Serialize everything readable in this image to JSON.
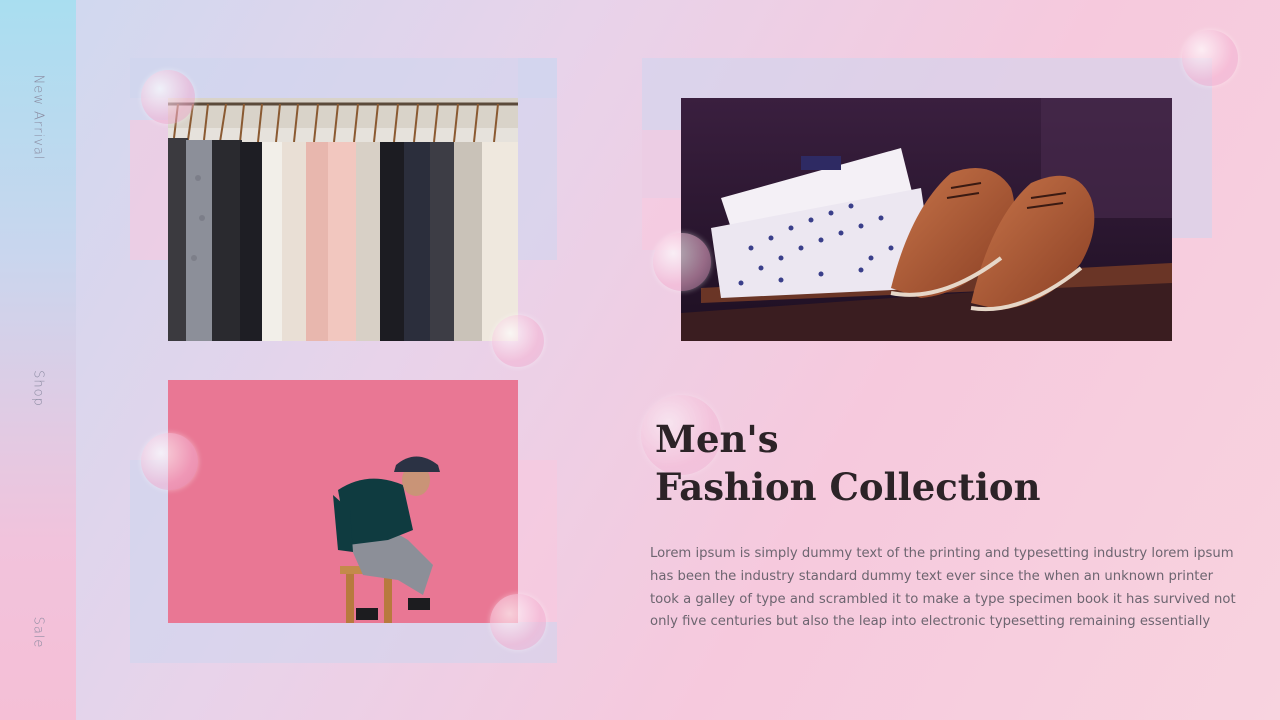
{
  "side_nav": {
    "items": [
      {
        "label": "New Arrival"
      },
      {
        "label": "Shop"
      },
      {
        "label": "Sale"
      }
    ]
  },
  "heading": {
    "line1": "Men's",
    "line2": "Fashion Collection"
  },
  "body": {
    "lines": [
      "Lorem ipsum is simply dummy text of the printing and typesetting industry lorem ipsum",
      "has been the industry standard dummy text ever since the when an unknown printer",
      "took  a galley of type and scrambled it to make a type specimen book  it has survived not",
      "only five centuries but also the leap into electronic typesetting remaining essentially"
    ]
  },
  "images": {
    "clothes_rack": "clothes-rack-photo",
    "shirt_shoes": "shirt-and-shoes-photo",
    "model_pink": "model-on-pink-wall-photo"
  },
  "colors": {
    "side_strip_top": "#a9def0",
    "side_strip_bottom": "#f5bfd6",
    "title": "#2c2327",
    "body_text": "#6d6570",
    "pink_wall": "#e7708f"
  }
}
